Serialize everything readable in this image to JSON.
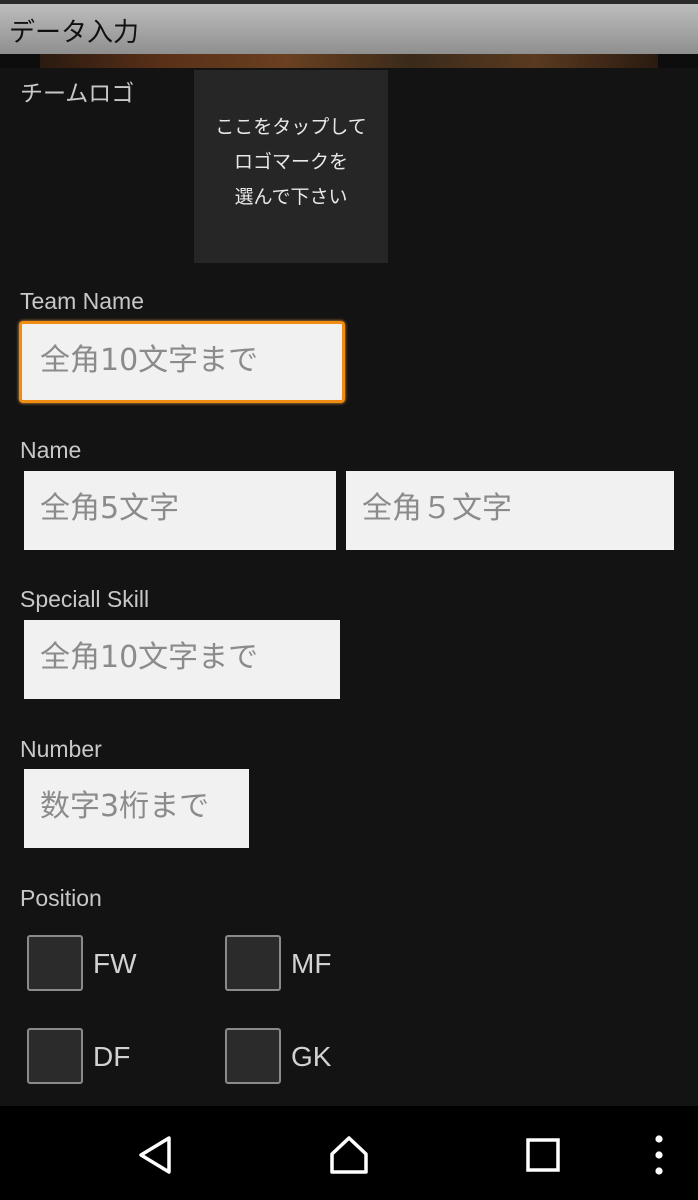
{
  "app": {
    "title": "データ入力"
  },
  "logo": {
    "label": "チームロゴ",
    "hint_lines": [
      "ここをタップして",
      "ロゴマークを",
      "選んで下さい"
    ]
  },
  "team_name": {
    "label": "Team Name",
    "placeholder": "全角10文字まで"
  },
  "name": {
    "label": "Name",
    "first_placeholder": "全角5文字",
    "last_placeholder": "全角５文字"
  },
  "special_skill": {
    "label": "Speciall Skill",
    "placeholder": "全角10文字まで"
  },
  "number": {
    "label": "Number",
    "placeholder": "数字3桁まで"
  },
  "position": {
    "label": "Position",
    "options": [
      {
        "label": "FW",
        "checked": false
      },
      {
        "label": "MF",
        "checked": false
      },
      {
        "label": "DF",
        "checked": false
      },
      {
        "label": "GK",
        "checked": false
      }
    ]
  },
  "navbar": {
    "icons": [
      "back-icon",
      "home-icon",
      "recents-icon",
      "overflow-menu-icon"
    ]
  },
  "colors": {
    "focus_accent": "#f08c12",
    "titlebar": "#a8a8a8",
    "background": "#131313"
  }
}
